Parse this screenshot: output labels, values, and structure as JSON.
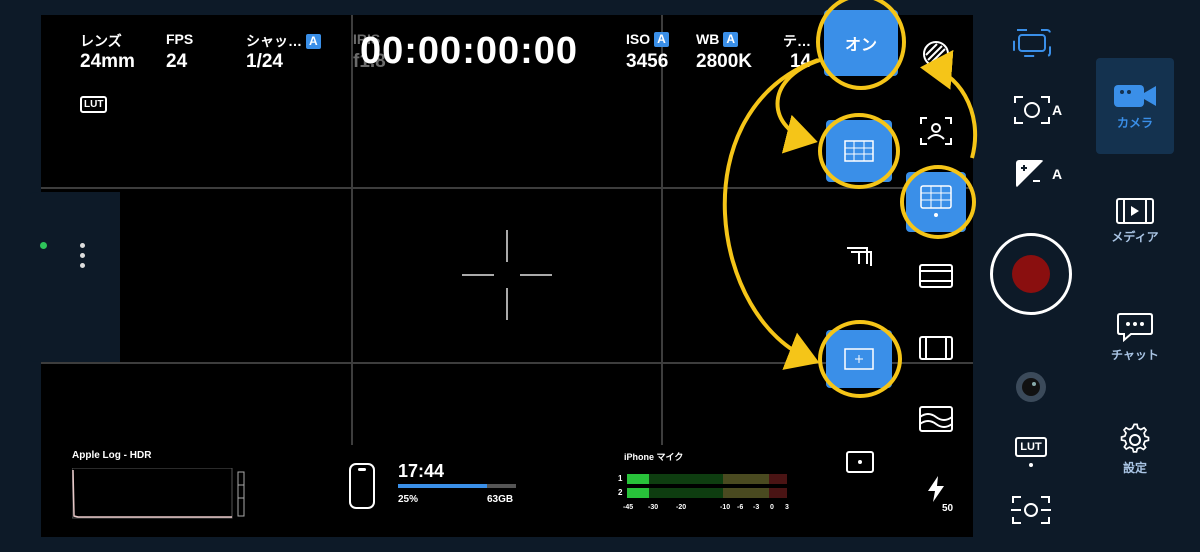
{
  "hud": {
    "lens": {
      "label": "レンズ",
      "value": "24mm"
    },
    "fps": {
      "label": "FPS",
      "value": "24"
    },
    "shutter": {
      "label": "シャッ…",
      "badge": "A",
      "value": "1/24"
    },
    "iris": {
      "label": "IRIS",
      "value": "f1.8"
    },
    "timecode": "00:00:00:00",
    "iso": {
      "label": "ISO",
      "badge": "A",
      "value": "3456"
    },
    "wb": {
      "label": "WB",
      "badge": "A",
      "value": "2800K"
    },
    "tint": {
      "label": "テ…",
      "value": "14"
    },
    "lut_badge": "LUT"
  },
  "bottom": {
    "codec": "Apple Log - HDR",
    "clock": "17:44",
    "battery": "25%",
    "battery_fraction": 0.25,
    "storage": "63GB",
    "storage_fill": 0.75,
    "mic_title": "iPhone マイク",
    "mic_channels": [
      "1",
      "2"
    ],
    "mic_scale": [
      "-45",
      "-30",
      "-20",
      "-10",
      "-6",
      "-3",
      "0",
      "3"
    ]
  },
  "grid_menu": {
    "on_button": "オン"
  },
  "right_controls": {
    "zebra_value": "50",
    "af_mode": "A",
    "exposure_mode": "A",
    "lut_button": "LUT"
  },
  "nav": {
    "camera": "カメラ",
    "media": "メディア",
    "chat": "チャット",
    "settings": "設定"
  },
  "colors": {
    "accent": "#3a8fe8",
    "highlight": "#f5c518",
    "record": "#8a0f0f",
    "sidebar": "#0d1a28"
  }
}
